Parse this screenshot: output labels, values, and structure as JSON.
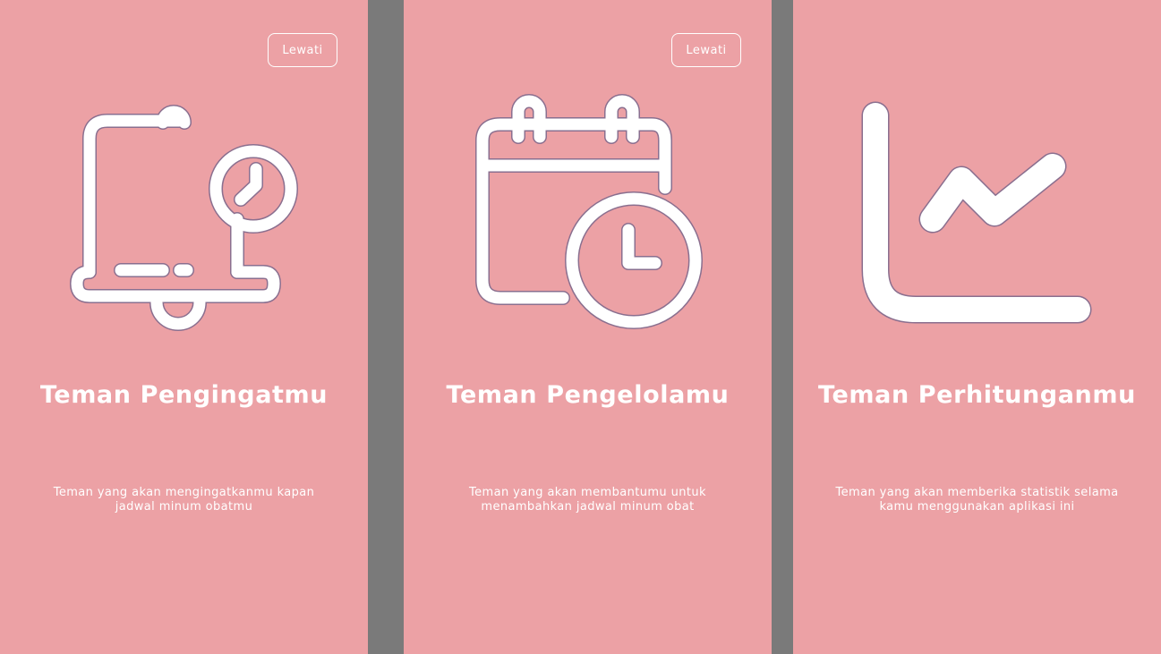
{
  "colors": {
    "screen_background": "#eca1a5",
    "gap_background": "#7a7a7a",
    "foreground": "#ffffff",
    "icon_outline": "#8a6f8f"
  },
  "screens": [
    {
      "skip_label": "Lewati",
      "icon": "bell-clock-icon",
      "title": "Teman Pengingatmu",
      "description": "Teman yang akan mengingatkanmu kapan jadwal minum obatmu"
    },
    {
      "skip_label": "Lewati",
      "icon": "calendar-clock-icon",
      "title": "Teman Pengelolamu",
      "description": "Teman yang akan membantumu untuk menambahkan jadwal minum obat"
    },
    {
      "icon": "line-chart-icon",
      "title": "Teman Perhitunganmu",
      "description": "Teman yang akan memberika statistik selama kamu menggunakan aplikasi ini"
    }
  ]
}
